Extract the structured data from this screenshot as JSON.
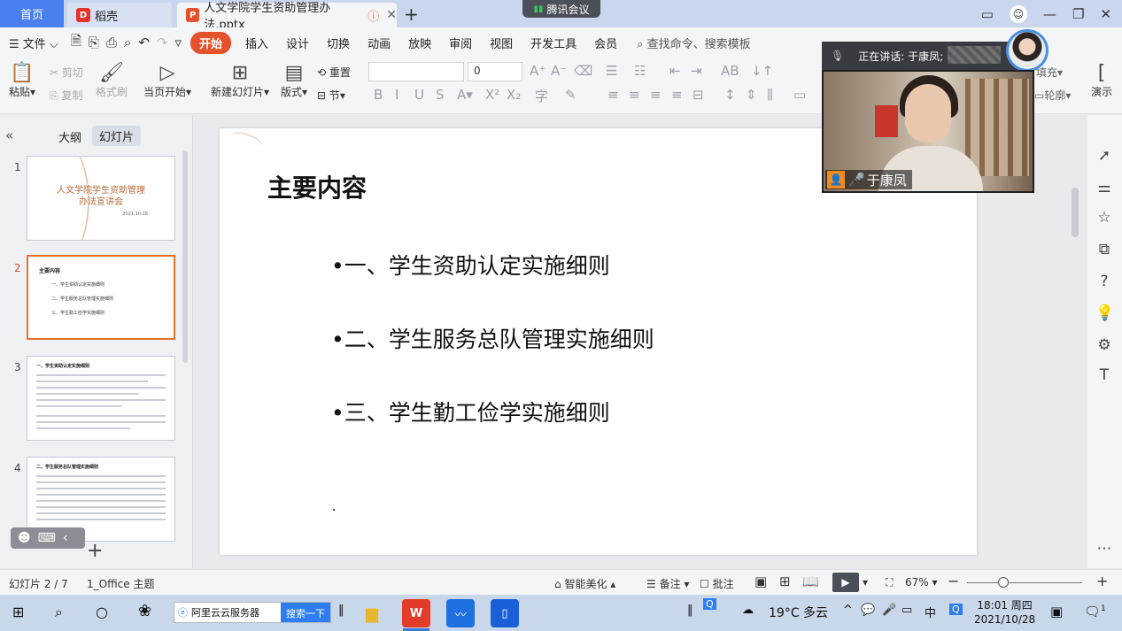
{
  "tabbar": {
    "home": "首页",
    "daoke": "稻壳",
    "doc_title": "人文学院学生资助管理办法.pptx",
    "meeting": "腾讯会议"
  },
  "menu": {
    "file": "文件",
    "items": [
      "开始",
      "插入",
      "设计",
      "切换",
      "动画",
      "放映",
      "审阅",
      "视图",
      "开发工具",
      "会员"
    ],
    "search": "查找命令、搜索模板"
  },
  "ribbon": {
    "paste": "粘贴",
    "cut": "剪切",
    "copy": "复制",
    "format_painter": "格式刷",
    "from_current": "当页开始",
    "new_slide": "新建幻灯片",
    "layout": "版式",
    "section": "节",
    "reset": "重置",
    "font_size": "0",
    "fill": "填充",
    "outline": "轮廓",
    "present": "演示"
  },
  "left_panel": {
    "tab_outline": "大纲",
    "tab_slides": "幻灯片",
    "thumb1_title": "人文学院学生资助管理办法宣讲会",
    "thumb1_date": "2021.10.28",
    "thumb2_title": "主要内容",
    "thumb2_items": [
      "一、学生资助认定实施细则",
      "二、学生服务总队管理实施细则",
      "三、学生勤工俭学实施细则"
    ],
    "thumb3_title": "一、学生资助认定实施细则",
    "thumb4_title": "二、学生服务总队管理实施细则",
    "numbers": [
      "1",
      "2",
      "3",
      "4"
    ]
  },
  "slide": {
    "title": "主要内容",
    "bullets": [
      "•一、学生资助认定实施细则",
      "•二、学生服务总队管理实施细则",
      "•三、学生勤工俭学实施细则"
    ]
  },
  "video": {
    "speaking": "正在讲话: 于康凤;",
    "name": "于康凤"
  },
  "status": {
    "slide_pos": "幻灯片 2 / 7",
    "theme": "1_Office 主题",
    "beautify": "智能美化",
    "notes": "备注",
    "comments": "批注",
    "zoom": "67%"
  },
  "taskbar": {
    "ie_text": "阿里云云服务器",
    "ie_btn": "搜索一下",
    "weather": "19°C 多云",
    "time": "18:01 周四",
    "date": "2021/10/28",
    "ime": "中",
    "notif_count": "1"
  }
}
